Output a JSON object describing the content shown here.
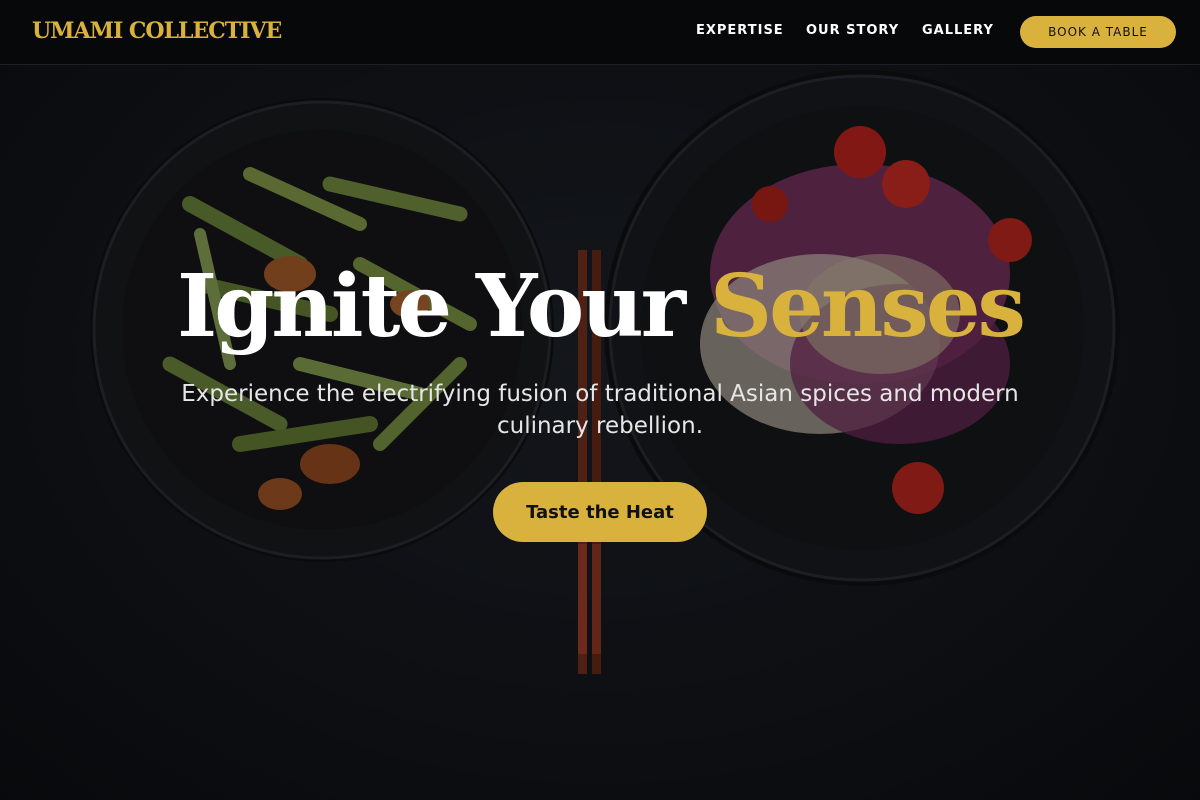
{
  "brand": {
    "name": "UMAMI COLLECTIVE"
  },
  "nav": {
    "items": [
      {
        "label": "EXPERTISE"
      },
      {
        "label": "OUR STORY"
      },
      {
        "label": "GALLERY"
      }
    ],
    "cta_label": "BOOK A TABLE"
  },
  "hero": {
    "title_main": "Ignite Your ",
    "title_accent": "Senses",
    "subtitle": "Experience the electrifying fusion of traditional Asian spices and modern culinary rebellion.",
    "cta_label": "Taste the Heat"
  },
  "colors": {
    "accent": "#d9b23e",
    "header_bg": "#07080a",
    "page_bg": "#15181e"
  },
  "images": {
    "left_bowl": "stir-fried-celery-shrimp-bowl",
    "right_bowl": "cabbage-tomato-noodle-salad-bowl",
    "center": "chopsticks"
  }
}
